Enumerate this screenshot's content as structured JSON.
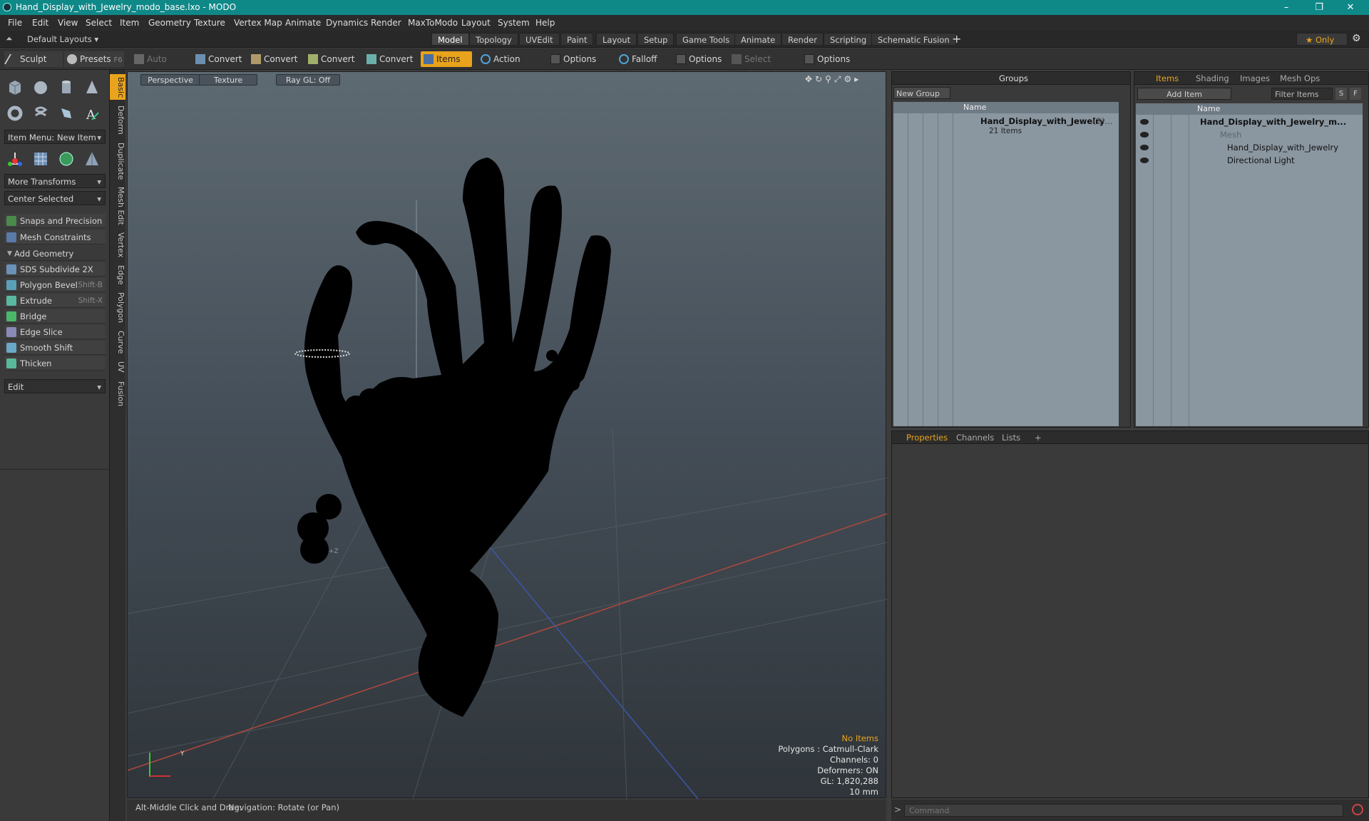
{
  "window": {
    "title": "Hand_Display_with_Jewelry_modo_base.lxo - MODO",
    "min": "–",
    "max": "❐",
    "close": "✕"
  },
  "menu": [
    "File",
    "Edit",
    "View",
    "Select",
    "Item",
    "Geometry",
    "Texture",
    "Vertex Map",
    "Animate",
    "Dynamics",
    "Render",
    "MaxToModo",
    "Layout",
    "System",
    "Help"
  ],
  "layout_bar": {
    "default_layouts": "Default Layouts ▾",
    "tabs": [
      "Model",
      "Topology",
      "UVEdit",
      "Paint",
      "Layout",
      "Setup",
      "Game Tools",
      "Animate",
      "Render",
      "Scripting",
      "Schematic Fusion"
    ],
    "active": "Model",
    "add": "+",
    "only": "★ Only",
    "gear": "⚙"
  },
  "toolbar": {
    "sculpt": "Sculpt",
    "presets": "Presets",
    "presets_key": "F6",
    "auto_select": "Auto Select",
    "convert": "Convert",
    "items": "Items",
    "action_center": "Action Center",
    "options": "Options",
    "falloff": "Falloff",
    "select_through": "Select Through"
  },
  "left": {
    "item_menu": "Item Menu: New Item",
    "more_transforms": "More Transforms",
    "center_selected": "Center Selected",
    "snaps": "Snaps and Precision",
    "mesh_constraints": "Mesh Constraints",
    "add_geometry": "Add Geometry",
    "tools": [
      {
        "label": "SDS Subdivide 2X",
        "key": ""
      },
      {
        "label": "Polygon Bevel",
        "key": "Shift-B"
      },
      {
        "label": "Extrude",
        "key": "Shift-X"
      },
      {
        "label": "Bridge",
        "key": ""
      },
      {
        "label": "Edge Slice",
        "key": ""
      },
      {
        "label": "Smooth Shift",
        "key": ""
      },
      {
        "label": "Thicken",
        "key": ""
      }
    ],
    "edit": "Edit"
  },
  "vtabs": [
    "Basic",
    "Deform",
    "Duplicate",
    "Mesh Edit",
    "Vertex",
    "Edge",
    "Polygon",
    "Curve",
    "UV",
    "Fusion"
  ],
  "viewport": {
    "perspective": "Perspective",
    "texture": "Texture",
    "raygl": "Ray GL: Off",
    "no_items": "No Items",
    "polygons": "Polygons : Catmull-Clark",
    "channels": "Channels: 0",
    "deformers": "Deformers: ON",
    "gl": "GL: 1,820,288",
    "scale": "10 mm",
    "axis_y": "Y",
    "axis_z": "+Z"
  },
  "status": {
    "hint": "Alt-Middle Click and Drag:",
    "nav": "Navigation: Rotate (or Pan)"
  },
  "groups": {
    "title": "Groups",
    "new_group": "New Group",
    "name_col": "Name",
    "row_name": "Hand_Display_with_Jewelry",
    "row_count": "(2)...",
    "row_items": "21 Items"
  },
  "items": {
    "tabs": [
      "Items",
      "Shading",
      "Images",
      "Mesh Ops"
    ],
    "add_item": "Add Item",
    "filter": "Filter Items",
    "s": "S",
    "f": "F",
    "name_col": "Name",
    "rows": [
      "Hand_Display_with_Jewelry_m...",
      "Mesh",
      "Hand_Display_with_Jewelry",
      "Directional Light"
    ]
  },
  "properties": {
    "tabs": [
      "Properties",
      "Channels",
      "Lists"
    ],
    "add": "+"
  },
  "command": {
    "placeholder": "Command",
    "arrow": ">"
  },
  "colors": {
    "accent": "#e9a31c",
    "title": "#0f8888"
  }
}
